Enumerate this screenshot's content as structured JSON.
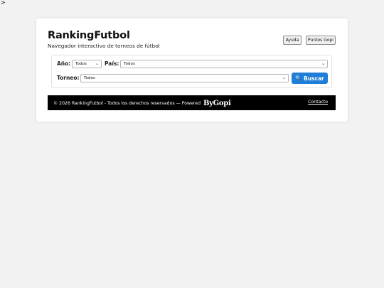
{
  "stray_char": ">",
  "header": {
    "title": "RankingFutbol",
    "subtitle": "Navegador interactivo de torneos de fútbol",
    "help_button": "Ayuda",
    "points_button": "Puntos Gopi"
  },
  "filters": {
    "year_label": "Año:",
    "year_value": "Todos",
    "country_label": "País:",
    "country_value": "Todos",
    "tournament_label": "Torneo:",
    "tournament_value": "Todos",
    "search_button": "Buscar",
    "search_icon": "🔍"
  },
  "footer": {
    "copyright": "© 2026 RankingFutbol - Todos los derechos reservados — Powered",
    "logo_text": "ByGopi",
    "contact_link": "Contacto"
  },
  "colors": {
    "accent": "#1f7ed8",
    "footer_bg": "#000000",
    "page_bg": "#f2f2f2"
  }
}
